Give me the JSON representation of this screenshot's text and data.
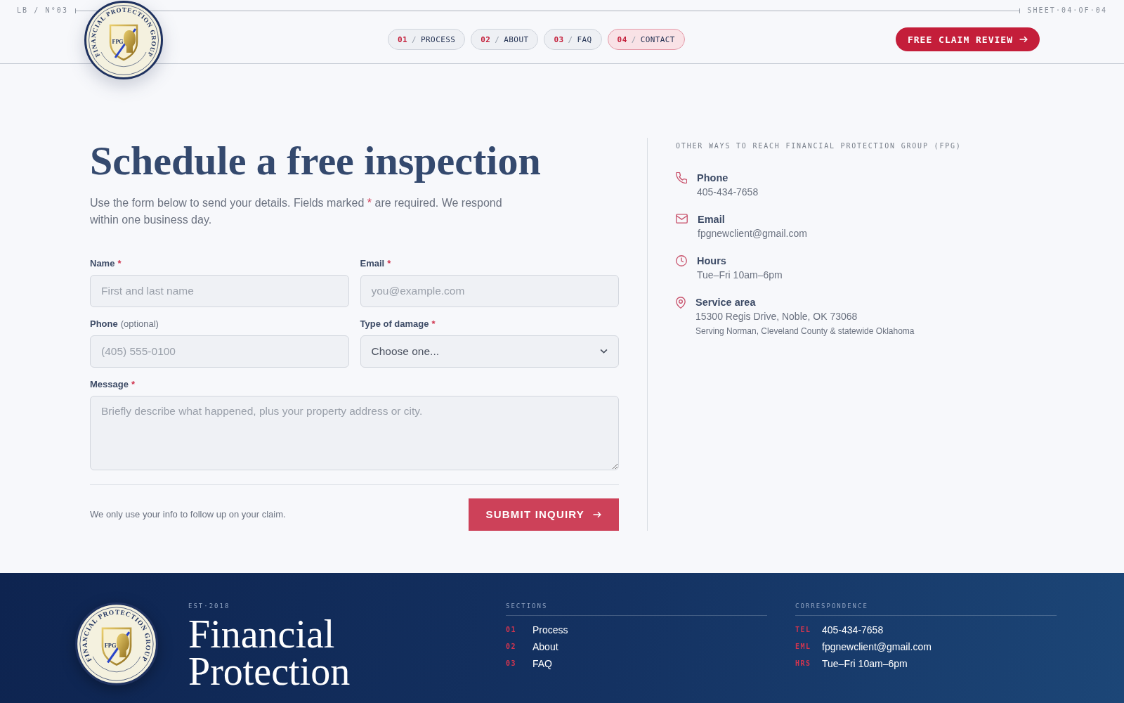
{
  "header": {
    "doc_code": "LB / N°03",
    "sheet_label": "SHEET·04·OF·04",
    "logo": {
      "ring_text": "FINANCIAL PROTECTION GROUP",
      "monogram": "FPG"
    },
    "nav": {
      "separator": "/",
      "items": [
        {
          "number": "01",
          "label": "PROCESS",
          "selected": false
        },
        {
          "number": "02",
          "label": "ABOUT",
          "selected": false
        },
        {
          "number": "03",
          "label": "FAQ",
          "selected": false
        },
        {
          "number": "04",
          "label": "CONTACT",
          "selected": true
        }
      ]
    },
    "cta_button": {
      "label": "FREE CLAIM REVIEW"
    }
  },
  "contact_form": {
    "title": "Schedule a free inspection",
    "intro": {
      "before": "Use the form below to send your details. Fields marked",
      "mark": "*",
      "after": "are required. We respond within one business day."
    },
    "fields": [
      {
        "kind": "input",
        "label": "Name",
        "required_mark": "*",
        "placeholder": "First and last name"
      },
      {
        "kind": "input",
        "label": "Email",
        "required_mark": "*",
        "placeholder": "you@example.com"
      },
      {
        "kind": "input",
        "label": "Phone",
        "note": "(optional)",
        "placeholder": "(405) 555-0100"
      },
      {
        "kind": "select",
        "label": "Type of damage",
        "required_mark": "*",
        "value": "Choose one..."
      },
      {
        "kind": "textarea",
        "label": "Message",
        "required_mark": "*",
        "placeholder": "Briefly describe what happened, plus your property address or city."
      }
    ],
    "privacy_note": "We only use your info to follow up on your claim.",
    "submit_button": {
      "label": "SUBMIT INQUIRY"
    }
  },
  "contact_info": {
    "heading": "OTHER WAYS TO REACH FINANCIAL PROTECTION GROUP (FPG)",
    "items": [
      {
        "kind": "phone",
        "title": "Phone",
        "value": "405-434-7658"
      },
      {
        "kind": "email",
        "title": "Email",
        "value": "fpgnewclient@gmail.com"
      },
      {
        "kind": "hours",
        "title": "Hours",
        "value": "Tue–Fri 10am–6pm"
      },
      {
        "kind": "location",
        "title": "Service area",
        "value": "15300 Regis Drive, Noble, OK 73068",
        "note": "Serving Norman, Cleveland County & statewide Oklahoma"
      }
    ]
  },
  "footer": {
    "logo": {
      "ring_text": "FINANCIAL PROTECTION GROUP",
      "monogram": "FPG"
    },
    "established": "EST·2018",
    "brand_lines": [
      "Financial",
      "Protection"
    ],
    "sections": {
      "heading": "SECTIONS",
      "items": [
        {
          "number": "01",
          "label": "Process"
        },
        {
          "number": "02",
          "label": "About"
        },
        {
          "number": "03",
          "label": "FAQ"
        }
      ]
    },
    "correspondence": {
      "heading": "CORRESPONDENCE",
      "items": [
        {
          "tag": "TEL",
          "value": "405-434-7658"
        },
        {
          "tag": "EML",
          "value": "fpgnewclient@gmail.com"
        },
        {
          "tag": "HRS",
          "value": "Tue–Fri 10am–6pm"
        }
      ]
    }
  }
}
